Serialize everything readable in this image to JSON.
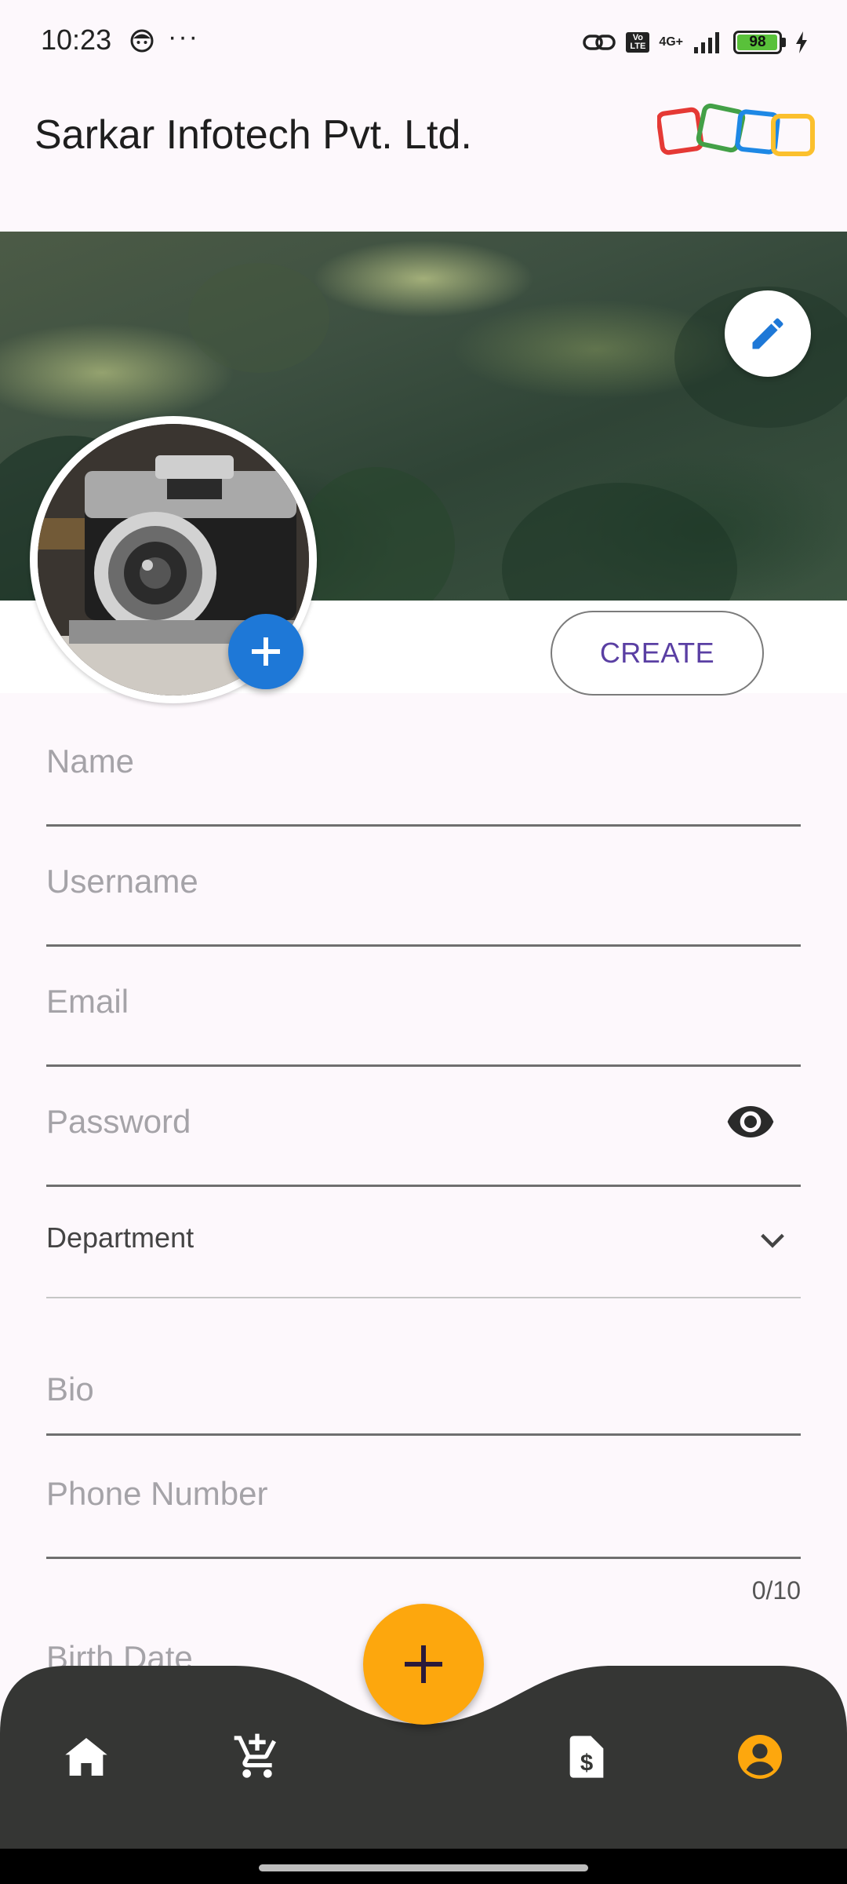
{
  "status_bar": {
    "time": "10:23",
    "more": "···",
    "network": "4G+",
    "volte": "Vo LTE",
    "battery": "98",
    "battery_level_percent": 98
  },
  "app_bar": {
    "title": "Sarkar Infotech Pvt. Ltd.",
    "logo_colors": [
      "#e53935",
      "#43a047",
      "#1e88e5",
      "#fbc02d"
    ]
  },
  "profile": {
    "create_label": "CREATE",
    "edit_icon": "pencil-icon",
    "add_photo_icon": "plus-icon"
  },
  "form": {
    "name_label": "Name",
    "username_label": "Username",
    "email_label": "Email",
    "password_label": "Password",
    "department_label": "Department",
    "bio_label": "Bio",
    "phone_label": "Phone Number",
    "phone_counter": "0/10",
    "birth_label": "Birth Date"
  },
  "bottom_nav": {
    "items": [
      "home-icon",
      "cart-add-icon",
      "invoice-dollar-icon",
      "account-icon"
    ],
    "active": "account-icon",
    "fab_icon": "plus-icon",
    "colors": {
      "bar": "#353634",
      "active": "#fda70d",
      "icon": "#ffffff",
      "fab": "#fda70d"
    }
  }
}
